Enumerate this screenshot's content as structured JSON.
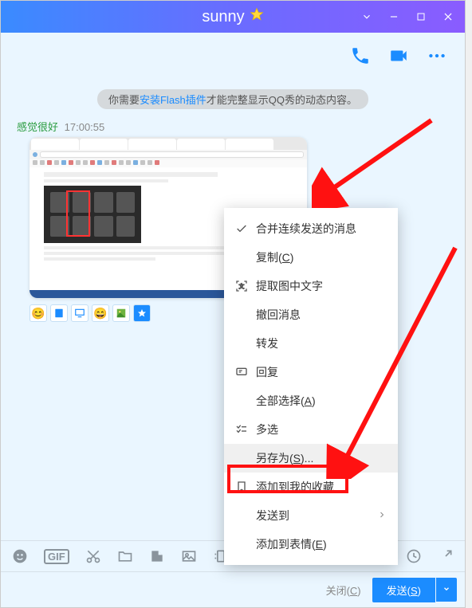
{
  "titlebar": {
    "title": "sunny"
  },
  "notice": {
    "prefix": "你需要",
    "link": "安装Flash插件",
    "suffix": "才能完整显示QQ秀的动态内容。"
  },
  "message": {
    "sender": "感觉很好",
    "time": "17:00:55"
  },
  "context_menu": {
    "merge": "合并连续发送的消息",
    "copy": "复制(C)",
    "ocr": "提取图中文字",
    "recall": "撤回消息",
    "forward": "转发",
    "reply": "回复",
    "select_all": "全部选择(A)",
    "multi_select": "多选",
    "save_as": "另存为(S)...",
    "add_fav": "添加到我的收藏",
    "send_to": "发送到",
    "add_emoji": "添加到表情(E)"
  },
  "footer": {
    "close": "关闭(C)",
    "send": "发送(S)"
  }
}
